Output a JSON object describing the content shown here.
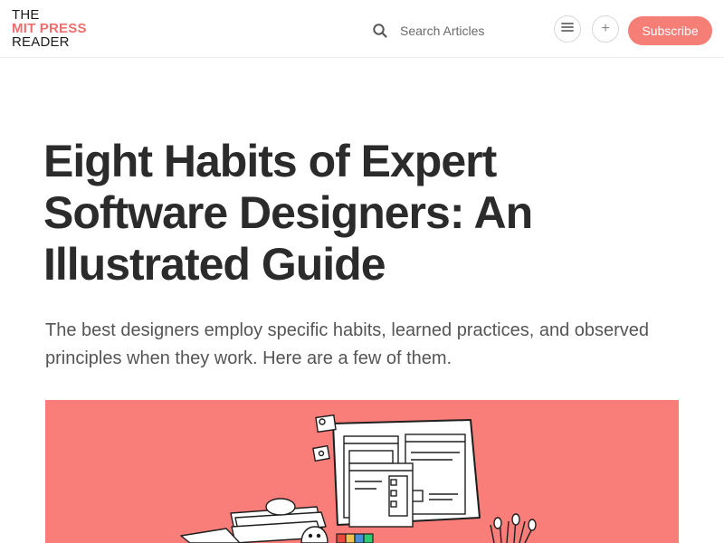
{
  "header": {
    "logo": {
      "line1": "THE",
      "line2": "MIT PRESS",
      "line3": "READER"
    },
    "search": {
      "placeholder": "Search Articles",
      "icon": "search-icon"
    },
    "menu_icon": "menu-icon",
    "plus_icon": "plus-icon",
    "plus_label": "+",
    "subscribe_label": "Subscribe"
  },
  "article": {
    "title": "Eight Habits of Expert Software Designers: An Illustrated Guide",
    "subtitle": "The best designers employ specific habits, learned practices, and observed principles when they work. Here are a few of them.",
    "hero_image": "illustration-of-designer-desk-with-monitors"
  },
  "colors": {
    "brand": "#f26d6d",
    "subscribe_bg": "#f57e77",
    "hero_bg": "#f97d78",
    "title": "#2b2b2b"
  }
}
